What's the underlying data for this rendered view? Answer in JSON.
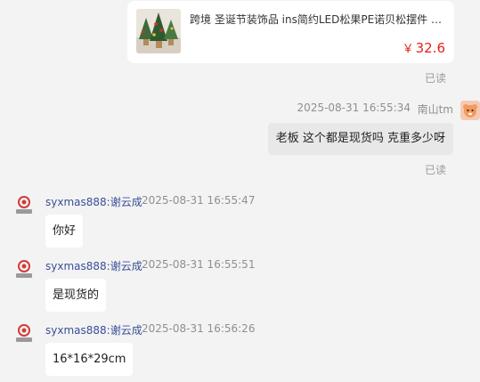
{
  "product": {
    "title": "跨境 圣诞节装饰品 ins简约LED松果PE诺贝松摆件 桌...",
    "currency": "￥",
    "price": "32.6"
  },
  "read_status_1": "已读",
  "buyer_message": {
    "timestamp": "2025-08-31 16:55:34",
    "sender": "南山tm",
    "text": "老板 这个都是现货吗 克重多少呀"
  },
  "read_status_2": "已读",
  "seller_messages": [
    {
      "sender": "syxmas888:谢云成",
      "timestamp": "2025-08-31 16:55:47",
      "text": "你好"
    },
    {
      "sender": "syxmas888:谢云成",
      "timestamp": "2025-08-31 16:55:51",
      "text": "是现货的"
    },
    {
      "sender": "syxmas888:谢云成",
      "timestamp": "2025-08-31 16:56:26",
      "text": "16*16*29cm"
    }
  ],
  "colors": {
    "price_red": "#e2231a",
    "seller_name_blue": "#3a4f9a",
    "buyer_bubble": "#e8e8e8",
    "seller_bubble": "#ffffff",
    "background": "#f3f3f3"
  },
  "icons": {
    "seller_avatar": "seller-logo-avatar",
    "buyer_avatar": "buyer-cartoon-avatar"
  }
}
